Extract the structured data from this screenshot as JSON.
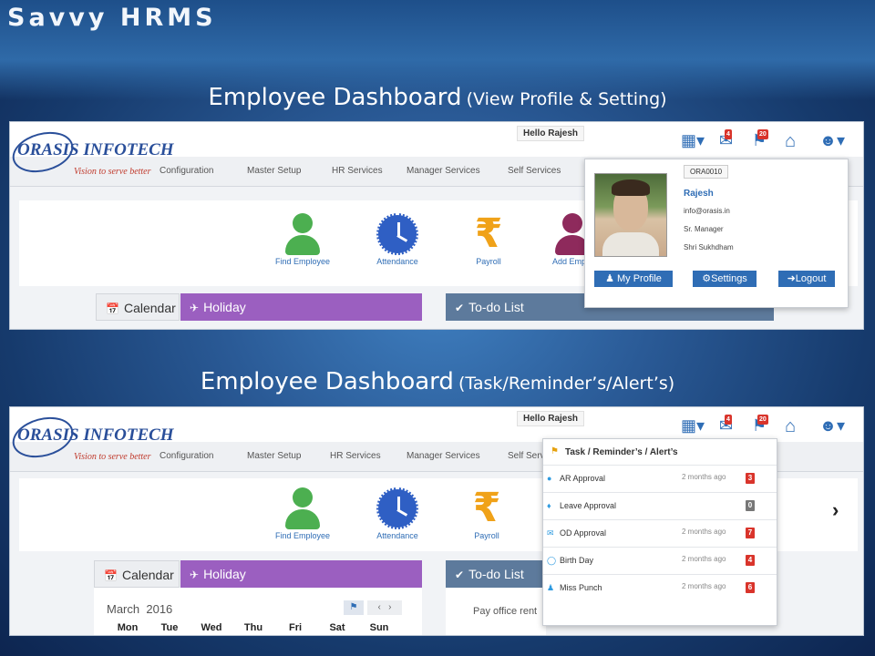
{
  "brand": "Savvy HRMS",
  "section1": {
    "title": "Employee Dashboard",
    "subtitle": "(View Profile & Setting)"
  },
  "section2": {
    "title": "Employee Dashboard",
    "subtitle": "(Task/Reminder’s/Alert’s)"
  },
  "logo": {
    "name": "ORASIS INFOTECH",
    "tagline": "Vision to serve better"
  },
  "header": {
    "hello": "Hello Rajesh",
    "badges": {
      "mail": "4",
      "alerts": "20"
    }
  },
  "nav": [
    "Configuration",
    "Master Setup",
    "HR Services",
    "Manager Services",
    "Self Services"
  ],
  "quick_links": [
    "Find Employee",
    "Attendance",
    "Payroll",
    "Add Emplo"
  ],
  "tabs": {
    "calendar": "Calendar",
    "holiday": "Holiday",
    "todo": "To-do List"
  },
  "profile": {
    "code": "ORA0010",
    "name": "Rajesh",
    "email": "info@orasis.in",
    "designation": "Sr. Manager",
    "location": "Shri Sukhdham",
    "buttons": {
      "my_profile": "My Profile",
      "settings": "Settings",
      "logout": "Logout"
    }
  },
  "notifications": {
    "title": "Task / Reminder’s / Alert’s",
    "items": [
      {
        "label": "AR Approval",
        "time": "2 months ago",
        "count": "3"
      },
      {
        "label": "Leave Approval",
        "time": "",
        "count": "0"
      },
      {
        "label": "OD Approval",
        "time": "2 months ago",
        "count": "7"
      },
      {
        "label": "Birth Day",
        "time": "2 months ago",
        "count": "4"
      },
      {
        "label": "Miss Punch",
        "time": "2 months ago",
        "count": "6"
      }
    ]
  },
  "calendar": {
    "month": "March",
    "year": "2016",
    "weekdays": [
      "Mon",
      "Tue",
      "Wed",
      "Thu",
      "Fri",
      "Sat",
      "Sun"
    ]
  },
  "todo": {
    "first_item": "Pay office rent"
  },
  "colors": {
    "accent": "#2f6db5",
    "holiday": "#9b5fc0",
    "todo": "#5d7a9c",
    "badge": "#d9342b"
  }
}
